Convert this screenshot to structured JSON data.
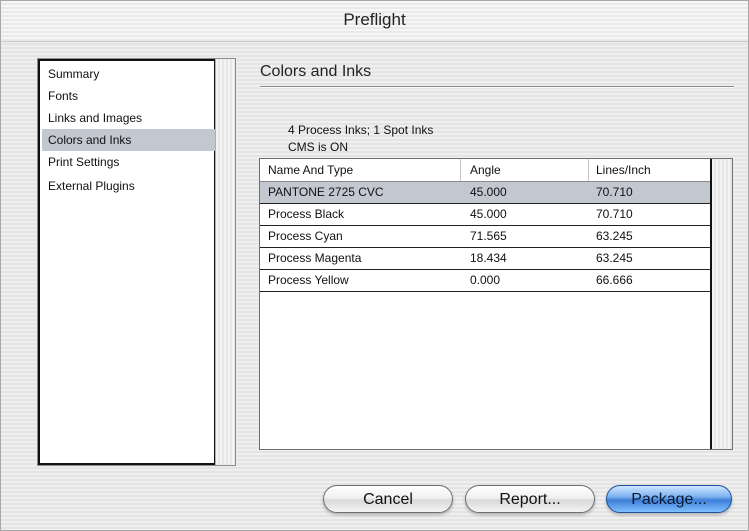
{
  "window": {
    "title": "Preflight"
  },
  "sidebar": {
    "items": [
      {
        "label": "Summary"
      },
      {
        "label": "Fonts"
      },
      {
        "label": "Links and Images"
      },
      {
        "label": "Colors and Inks"
      },
      {
        "label": "Print Settings"
      },
      {
        "label": "External Plugins"
      }
    ]
  },
  "main": {
    "section_title": "Colors and Inks",
    "info_inks": "4 Process Inks; 1 Spot Inks",
    "info_cms": "CMS is ON",
    "table": {
      "columns": [
        "Name And Type",
        "Angle",
        "Lines/Inch"
      ],
      "rows": [
        [
          "PANTONE 2725 CVC",
          "45.000",
          "70.710"
        ],
        [
          "Process Black",
          "45.000",
          "70.710"
        ],
        [
          "Process Cyan",
          "71.565",
          "63.245"
        ],
        [
          "Process Magenta",
          "18.434",
          "63.245"
        ],
        [
          "Process Yellow",
          "0.000",
          "66.666"
        ]
      ]
    }
  },
  "buttons": {
    "cancel": "Cancel",
    "report": "Report...",
    "package": "Package..."
  },
  "colors": {
    "selection": "#c3c7d0",
    "default_button": "#3e7fd8"
  }
}
